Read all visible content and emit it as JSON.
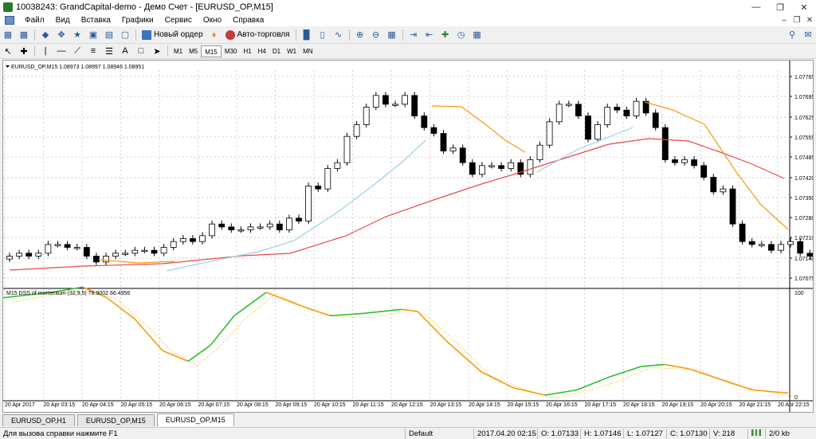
{
  "window": {
    "title": "10038243: GrandCapital-demo - Демо Счет - [EURUSD_OP,M15]"
  },
  "menu": [
    "Файл",
    "Вид",
    "Вставка",
    "Графики",
    "Сервис",
    "Окно",
    "Справка"
  ],
  "toolbar": {
    "new_order": "Новый ордер",
    "auto_trading": "Авто-торговля"
  },
  "timeframes": [
    "M1",
    "M5",
    "M15",
    "M30",
    "H1",
    "H4",
    "D1",
    "W1",
    "MN"
  ],
  "active_timeframe": "M15",
  "drawing_tools": {
    "text_tool": "A"
  },
  "chart": {
    "header": "EURUSD_OP,M15  1.08973 1.08997 1.08946 1.08951",
    "price_ticks": [
      "1.07765",
      "1.07695",
      "1.07625",
      "1.07555",
      "1.07485",
      "1.07420",
      "1.07350",
      "1.07280",
      "1.07210",
      "1.07140",
      "1.07075"
    ],
    "time_ticks": [
      "20 Apr 2017",
      "20 Apr 03:15",
      "20 Apr 04:15",
      "20 Apr 05:15",
      "20 Apr 06:15",
      "20 Apr 07:15",
      "20 Apr 08:15",
      "20 Apr 09:15",
      "20 Apr 10:15",
      "20 Apr 11:15",
      "20 Apr 12:15",
      "20 Apr 13:15",
      "20 Apr 14:15",
      "20 Apr 15:15",
      "20 Apr 16:15",
      "20 Apr 17:15",
      "20 Apr 18:15",
      "20 Apr 19:15",
      "20 Apr 20:15",
      "20 Apr 21:15",
      "20 Apr 22:15"
    ],
    "indicator_label": "M15 DSS of momentum (32,9,5) 78.9002 66.4956",
    "indicator_scale": [
      "100",
      "0"
    ],
    "colors": {
      "bull": "#ffffff",
      "bear": "#000000",
      "ma_fast": "#9fcfe6",
      "ma_orange": "#f39c12",
      "ma_red": "#e84a4a",
      "dss_up": "#2bbf2b",
      "dss_down": "#f39c12",
      "dss_signal": "#f5c518"
    }
  },
  "tabs": [
    "EURUSD_OP,H1",
    "EURUSD_OP,M15",
    "EURUSD_OP,M15"
  ],
  "active_tab": 2,
  "status": {
    "help": "Для вызова справки нажмите F1",
    "profile": "Default",
    "datetime": "2017.04.20 02:15",
    "open": "O: 1.07133",
    "high": "H: 1.07146",
    "low": "L: 1.07127",
    "close": "C: 1.07130",
    "volume": "V: 218",
    "traffic": "2/0 kb"
  }
}
